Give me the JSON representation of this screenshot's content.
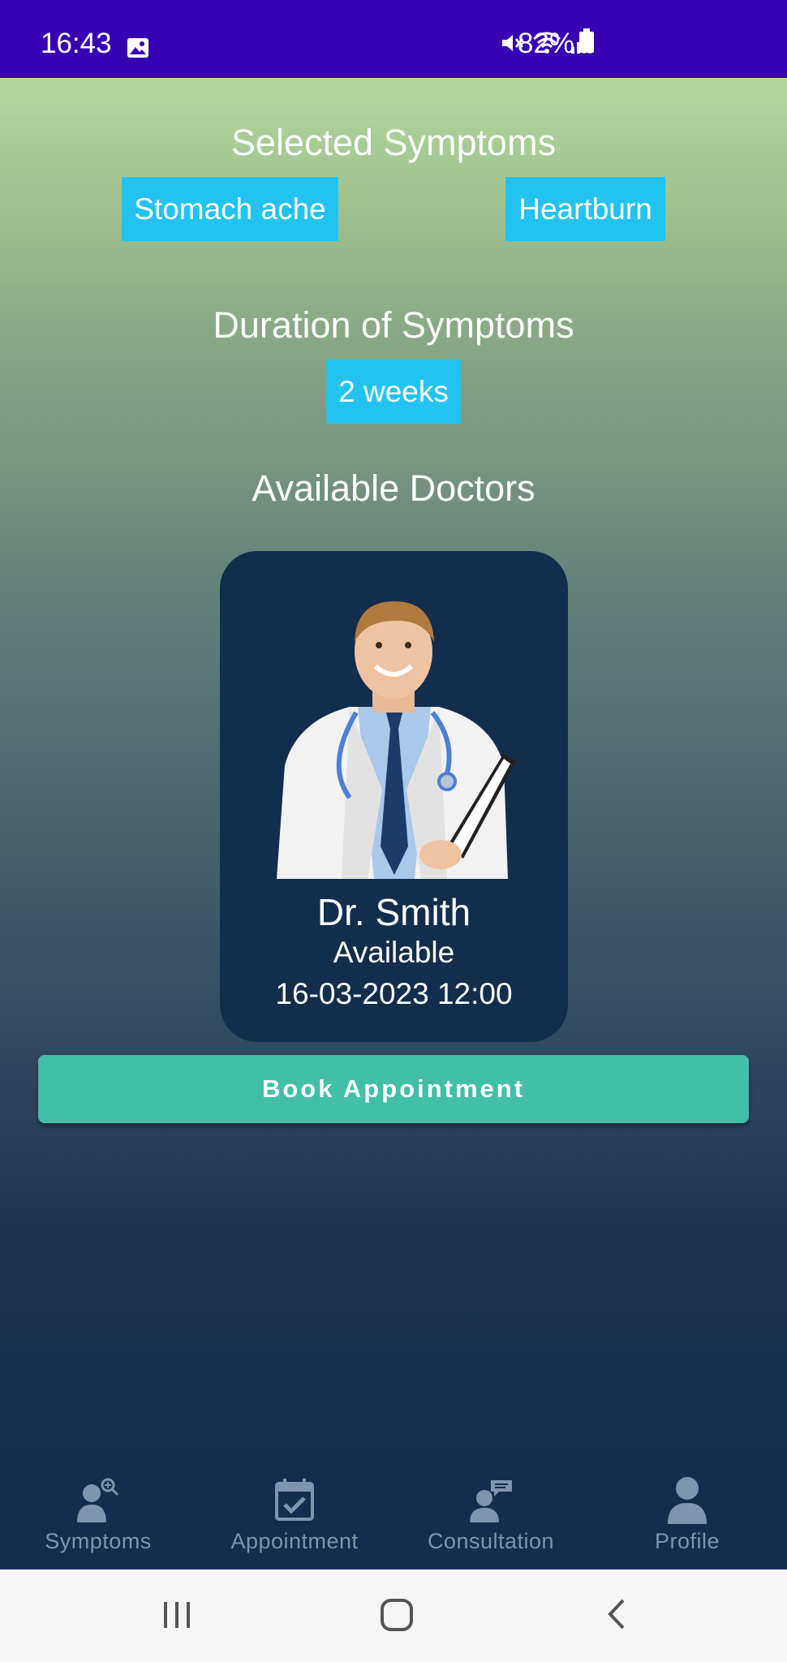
{
  "status_bar": {
    "time": "16:43",
    "battery": "82%",
    "icons": [
      "gallery-icon",
      "mute-icon",
      "wifi-icon",
      "signal-icon",
      "battery-icon"
    ]
  },
  "main": {
    "selected_symptoms_title": "Selected Symptoms",
    "symptoms": [
      "Stomach ache",
      "Heartburn"
    ],
    "duration_title": "Duration of Symptoms",
    "duration": "2 weeks",
    "doctors_title": "Available Doctors",
    "doctor": {
      "name": "Dr. Smith",
      "status": "Available",
      "datetime": "16-03-2023 12:00"
    },
    "book_button": "Book Appointment"
  },
  "bottom_nav": {
    "items": [
      {
        "label": "Symptoms",
        "icon": "symptoms-icon"
      },
      {
        "label": "Appointment",
        "icon": "calendar-check-icon"
      },
      {
        "label": "Consultation",
        "icon": "consultation-icon"
      },
      {
        "label": "Profile",
        "icon": "profile-icon"
      }
    ]
  },
  "colors": {
    "status_bar": "#3700b3",
    "chip": "#23c3ef",
    "card": "#132d4d",
    "button": "#41bfa7",
    "nav_bg": "#142c4d",
    "nav_icon": "#7f94ad"
  }
}
